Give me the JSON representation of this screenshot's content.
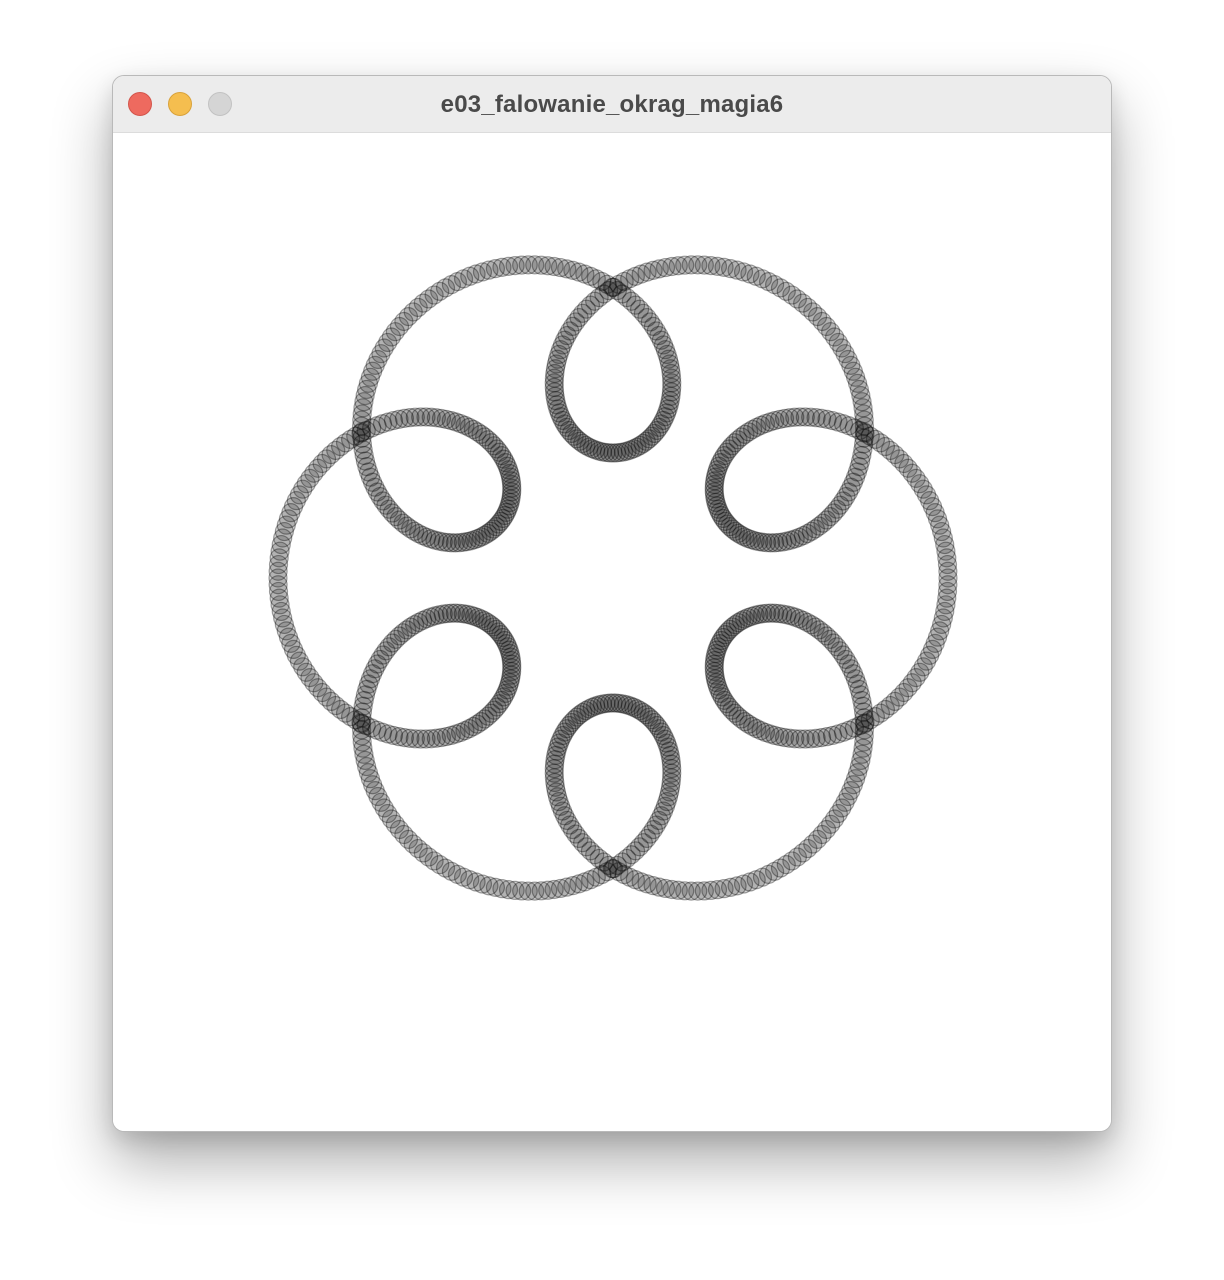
{
  "window": {
    "title": "e03_falowanie_okrag_magia6"
  },
  "controls": {
    "close_color": "#ee6a5f",
    "minimize_color": "#f5be4f",
    "zoom_color": "#d5d5d5"
  },
  "sketch": {
    "background": "#ffffff",
    "dot_color": "#000000",
    "petal_count": 6
  }
}
